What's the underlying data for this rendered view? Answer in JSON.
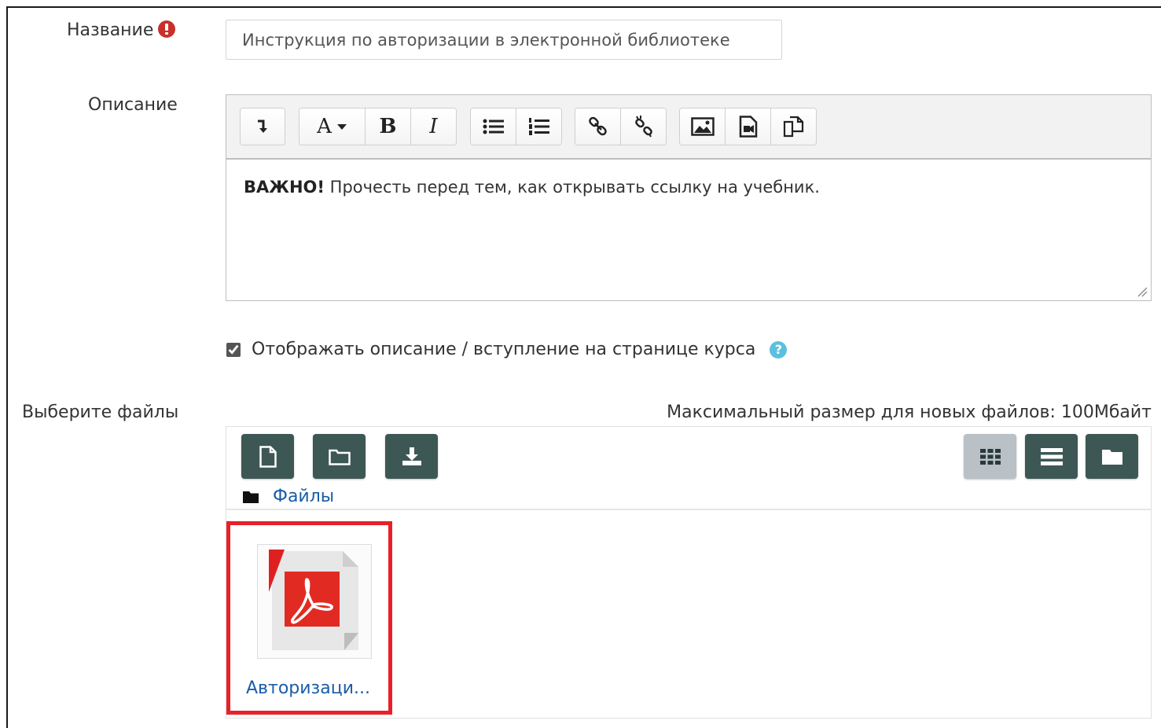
{
  "form": {
    "name_label": "Название",
    "name_value": "Инструкция по авторизации в электронной библиотеке",
    "description_label": "Описание",
    "editor_text_bold": "ВАЖНО!",
    "editor_text_rest": " Прочесть перед тем, как открывать ссылку на учебник.",
    "show_description_label": "Отображать описание / вступление на странице курса",
    "show_description_checked": true,
    "help_glyph": "?",
    "files_label": "Выберите файлы",
    "max_size_text": "Максимальный размер для новых файлов: 100Мбайт"
  },
  "editor_toolbar": {
    "font_button": "A",
    "bold_button": "B",
    "italic_button": "I",
    "icons": [
      "expand-toolbar-icon",
      "font-style-icon",
      "bold-icon",
      "italic-icon",
      "unordered-list-icon",
      "ordered-list-icon",
      "link-icon",
      "unlink-icon",
      "image-icon",
      "media-icon",
      "manage-files-icon"
    ]
  },
  "file_manager": {
    "breadcrumb_label": "Файлы",
    "view_modes": [
      "icons",
      "list",
      "tree"
    ],
    "active_view": "icons",
    "files": [
      {
        "name": "Авторизаци...",
        "type": "pdf"
      }
    ]
  },
  "colors": {
    "button_dark": "#3d5754",
    "button_active": "#b9c0c6",
    "link": "#1a5ca8",
    "highlight_border": "#e8202a",
    "required": "#c9302c",
    "help": "#5bc0de"
  }
}
